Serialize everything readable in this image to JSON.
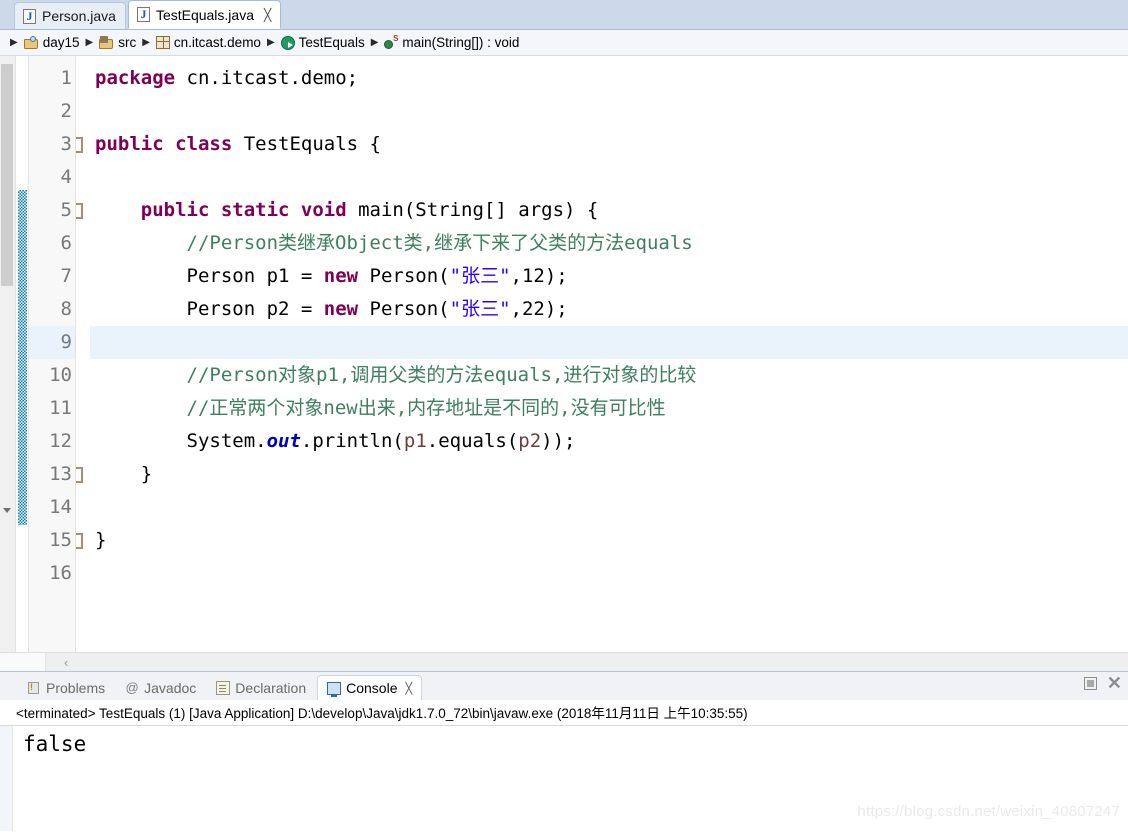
{
  "editor_tabs": [
    {
      "label": "Person.java",
      "icon": "java-file-icon",
      "active": false,
      "closable": false
    },
    {
      "label": "TestEquals.java",
      "icon": "java-file-icon",
      "active": true,
      "closable": true,
      "close_glyph": "╳"
    }
  ],
  "breadcrumb": {
    "separator": "▶",
    "items": [
      {
        "label": "day15",
        "icon": "java-project-icon"
      },
      {
        "label": "src",
        "icon": "source-folder-icon"
      },
      {
        "label": "cn.itcast.demo",
        "icon": "package-icon"
      },
      {
        "label": "TestEquals",
        "icon": "class-icon"
      },
      {
        "label": "main(String[]) : void",
        "icon": "static-method-icon"
      }
    ]
  },
  "code": {
    "lines": [
      {
        "n": "1",
        "segments": [
          {
            "t": "package ",
            "c": "kw"
          },
          {
            "t": "cn.itcast.demo;",
            "c": ""
          }
        ]
      },
      {
        "n": "2",
        "segments": []
      },
      {
        "n": "3",
        "segments": [
          {
            "t": "public class ",
            "c": "kw"
          },
          {
            "t": "TestEquals {",
            "c": ""
          }
        ]
      },
      {
        "n": "4",
        "segments": []
      },
      {
        "n": "5",
        "segments": [
          {
            "t": "    ",
            "c": ""
          },
          {
            "t": "public static void ",
            "c": "kw"
          },
          {
            "t": "main(String[] args) {",
            "c": ""
          }
        ]
      },
      {
        "n": "6",
        "segments": [
          {
            "t": "        //Person类继承Object类,继承下来了父类的方法equals",
            "c": "cmt"
          }
        ]
      },
      {
        "n": "7",
        "segments": [
          {
            "t": "        Person p1 = ",
            "c": ""
          },
          {
            "t": "new",
            "c": "kw"
          },
          {
            "t": " Person(",
            "c": ""
          },
          {
            "t": "\"张三\"",
            "c": "str"
          },
          {
            "t": ",12);",
            "c": ""
          }
        ]
      },
      {
        "n": "8",
        "segments": [
          {
            "t": "        Person p2 = ",
            "c": ""
          },
          {
            "t": "new",
            "c": "kw"
          },
          {
            "t": " Person(",
            "c": ""
          },
          {
            "t": "\"张三\"",
            "c": "str"
          },
          {
            "t": ",22);",
            "c": ""
          }
        ]
      },
      {
        "n": "9",
        "segments": [],
        "current": true
      },
      {
        "n": "10",
        "segments": [
          {
            "t": "        //Person对象p1,调用父类的方法equals,进行对象的比较",
            "c": "cmt"
          }
        ]
      },
      {
        "n": "11",
        "segments": [
          {
            "t": "        //正常两个对象new出来,内存地址是不同的,没有可比性",
            "c": "cmt"
          }
        ]
      },
      {
        "n": "12",
        "segments": [
          {
            "t": "        System.",
            "c": ""
          },
          {
            "t": "out",
            "c": "fld"
          },
          {
            "t": ".println(",
            "c": ""
          },
          {
            "t": "p1",
            "c": "lvar"
          },
          {
            "t": ".equals(",
            "c": ""
          },
          {
            "t": "p2",
            "c": "lvar"
          },
          {
            "t": "));",
            "c": ""
          }
        ]
      },
      {
        "n": "13",
        "segments": [
          {
            "t": "    }",
            "c": ""
          }
        ]
      },
      {
        "n": "14",
        "segments": []
      },
      {
        "n": "15",
        "segments": [
          {
            "t": "}",
            "c": ""
          }
        ]
      },
      {
        "n": "16",
        "segments": []
      }
    ],
    "fold_marker_lines": [
      3,
      5,
      13,
      15
    ]
  },
  "editor_scroll": {
    "left_arrow_glyph": "‹"
  },
  "console": {
    "tabs": [
      {
        "label": "Problems",
        "icon": "problems-icon",
        "active": false
      },
      {
        "label": "Javadoc",
        "icon": "javadoc-icon",
        "active": false,
        "glyph": "@"
      },
      {
        "label": "Declaration",
        "icon": "declaration-icon",
        "active": false
      },
      {
        "label": "Console",
        "icon": "console-icon",
        "active": true,
        "close_glyph": "╳"
      }
    ],
    "actions": [
      {
        "name": "minimize-button",
        "glyph": ""
      },
      {
        "name": "close-button",
        "glyph": "✕"
      }
    ],
    "command_line": "<terminated> TestEquals (1) [Java Application] D:\\develop\\Java\\jdk1.7.0_72\\bin\\javaw.exe (2018年11月11日 上午10:35:55)",
    "output": "false"
  },
  "watermark": "https://blog.csdn.net/weixin_40807247",
  "colors": {
    "tabbar_bg": "#ccd9e8",
    "keyword": "#7f0055",
    "string": "#2a00ff",
    "comment": "#3f7f5f",
    "static_field": "#0000c0",
    "local_var": "#6a3e3e",
    "current_line": "#eaf2fb",
    "fold_stripe": "#007ac2"
  }
}
